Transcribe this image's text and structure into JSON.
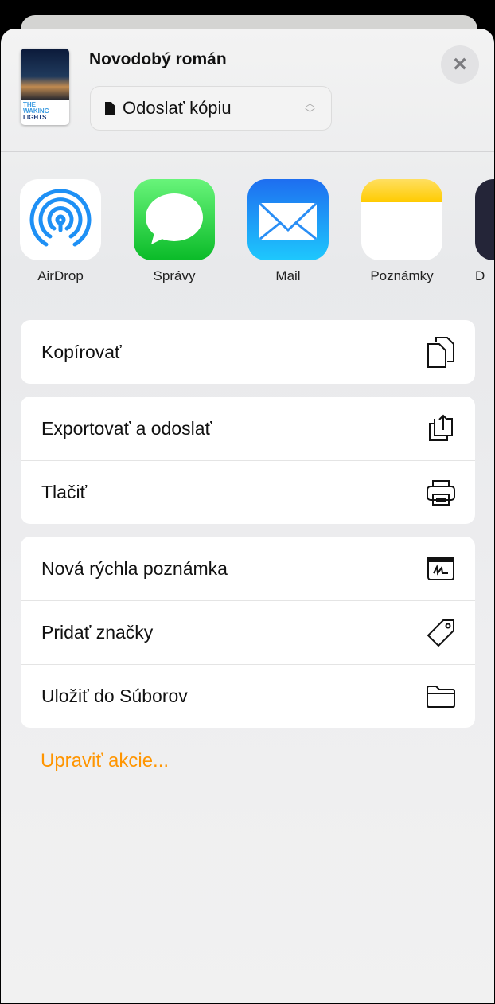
{
  "header": {
    "title": "Novodobý román",
    "cover_text": [
      "THE",
      "WAKING",
      "LIGHTS"
    ],
    "select_value": "Odoslať kópiu",
    "close_label": "×"
  },
  "apps": [
    {
      "label": "AirDrop",
      "icon": "airdrop-icon"
    },
    {
      "label": "Správy",
      "icon": "messages-icon"
    },
    {
      "label": "Mail",
      "icon": "mail-icon"
    },
    {
      "label": "Poznámky",
      "icon": "notes-icon"
    },
    {
      "label": "D",
      "icon": "app-icon"
    }
  ],
  "actions": [
    [
      {
        "label": "Kopírovať",
        "icon": "copy-icon"
      }
    ],
    [
      {
        "label": "Exportovať a odoslať",
        "icon": "share-icon"
      },
      {
        "label": "Tlačiť",
        "icon": "printer-icon"
      }
    ],
    [
      {
        "label": "Nová rýchla poznámka",
        "icon": "quick-note-icon"
      },
      {
        "label": "Pridať značky",
        "icon": "tag-icon"
      },
      {
        "label": "Uložiť do Súborov",
        "icon": "folder-icon"
      }
    ]
  ],
  "edit_actions": "Upraviť akcie...",
  "colors": {
    "accent": "#ff9500",
    "airdrop": "#1e90f5"
  }
}
